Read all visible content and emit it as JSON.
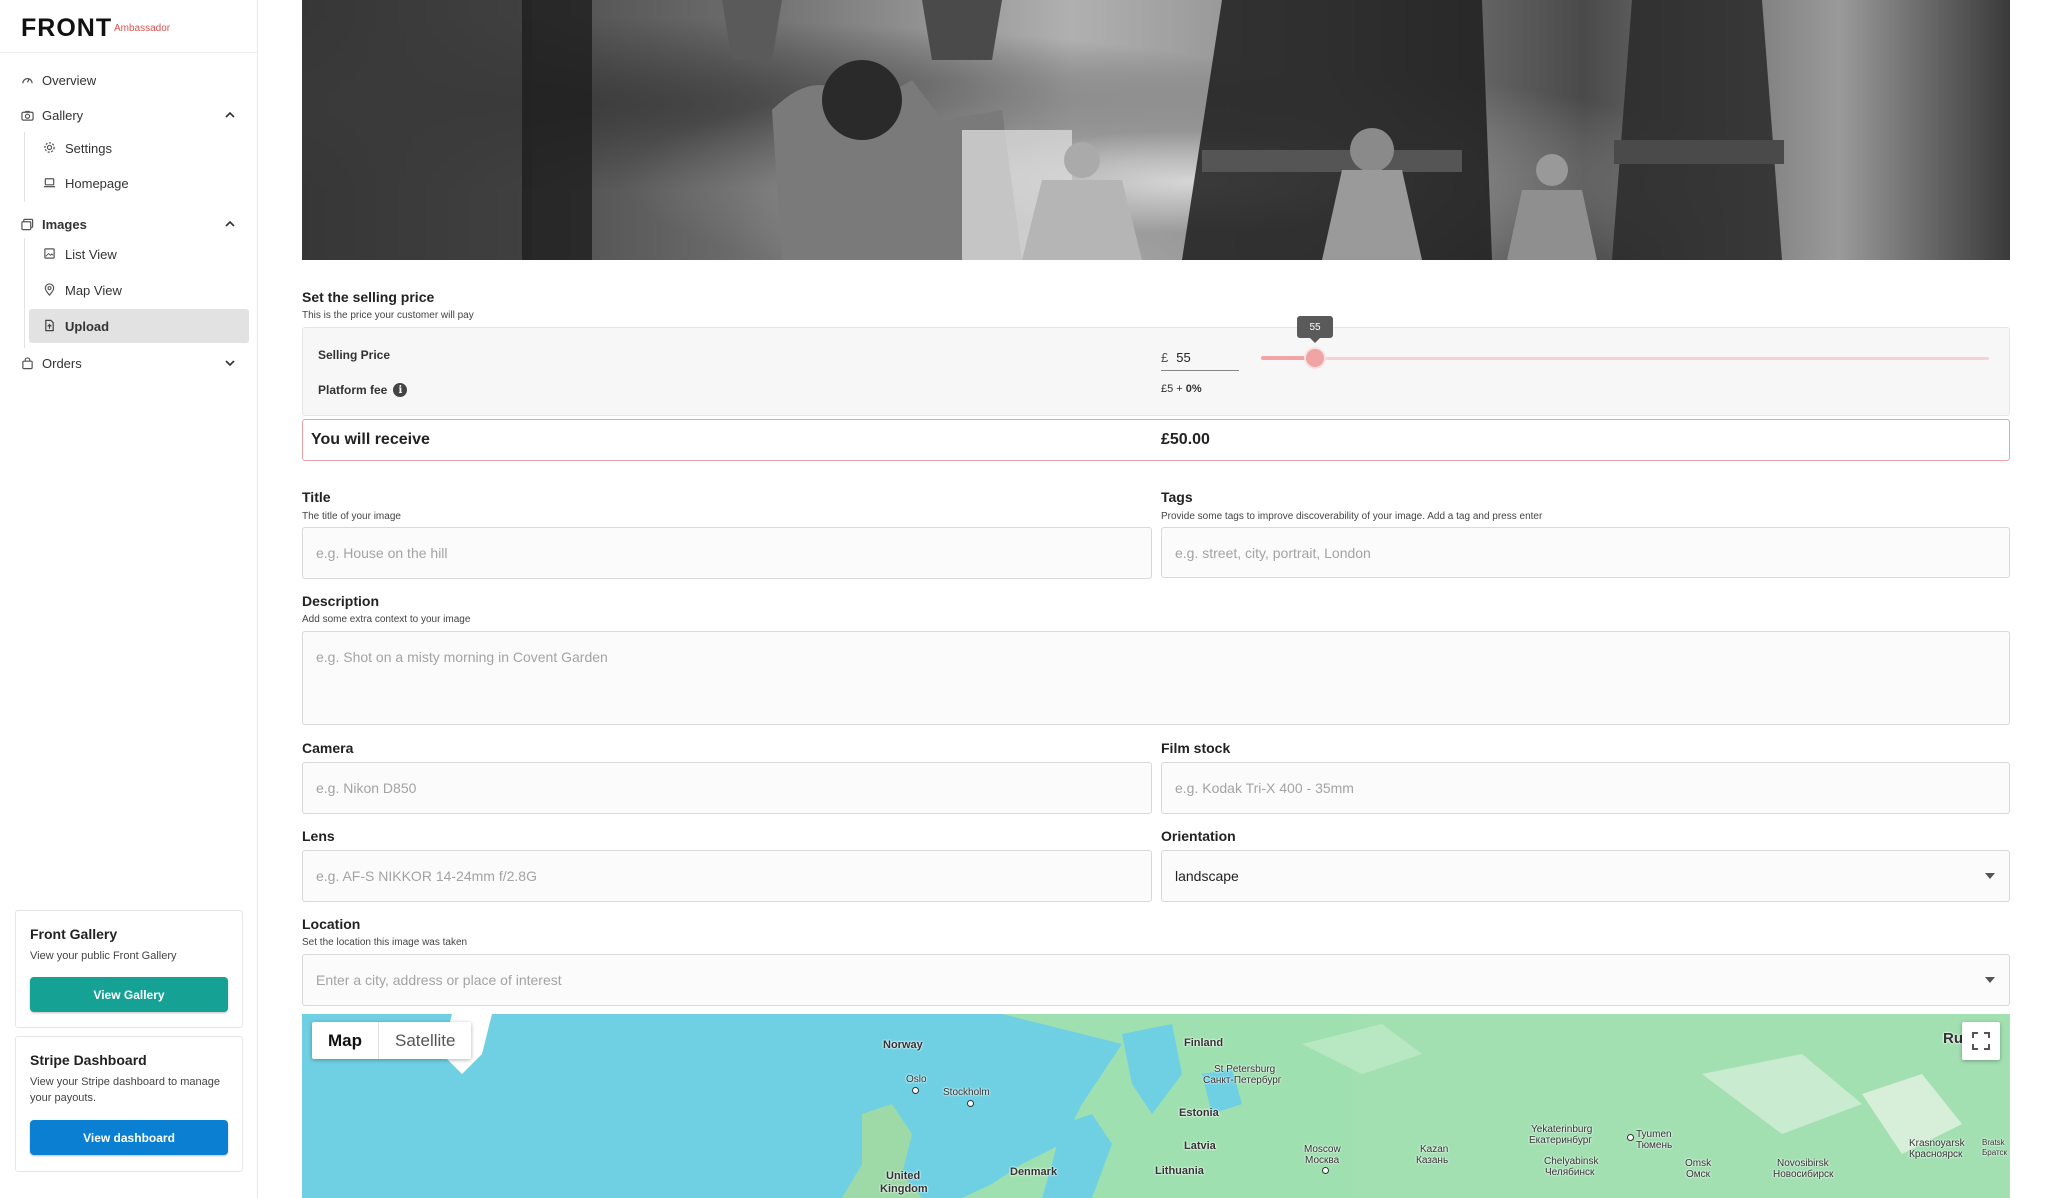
{
  "brand": {
    "logo": "FRONT",
    "sub": "Ambassador"
  },
  "sidebar": {
    "overview": "Overview",
    "gallery": "Gallery",
    "gallery_items": [
      "Settings",
      "Homepage"
    ],
    "images": "Images",
    "images_items": [
      "List View",
      "Map View",
      "Upload"
    ],
    "orders": "Orders",
    "active_item": "Upload"
  },
  "cards": {
    "front": {
      "title": "Front Gallery",
      "text": "View your public Front Gallery",
      "button": "View Gallery",
      "color": "#15a193"
    },
    "stripe": {
      "title": "Stripe Dashboard",
      "text": "View your Stripe dashboard to manage your payouts.",
      "button": "View dashboard",
      "color": "#0b7fd1"
    }
  },
  "pricing": {
    "title": "Set the selling price",
    "help": "This is the price your customer will pay",
    "selling_label": "Selling Price",
    "currency": "£",
    "selling_value": "55",
    "slider_value": 55,
    "slider_fraction": 0.074,
    "tooltip": "55",
    "fee_label": "Platform fee",
    "fee_base": "£5 + ",
    "fee_percent": "0%",
    "receive_label": "You will receive",
    "receive_value": "£50.00",
    "accent": "#f0a4a4"
  },
  "form": {
    "title": {
      "label": "Title",
      "help": "The title of your image",
      "placeholder": "e.g. House on the hill"
    },
    "tags": {
      "label": "Tags",
      "help": "Provide some tags to improve discoverability of your image. Add a tag and press enter",
      "placeholder": "e.g. street, city, portrait, London"
    },
    "description": {
      "label": "Description",
      "help": "Add some extra context to your image",
      "placeholder": "e.g. Shot on a misty morning in Covent Garden"
    },
    "camera": {
      "label": "Camera",
      "placeholder": "e.g. Nikon D850"
    },
    "film": {
      "label": "Film stock",
      "placeholder": "e.g. Kodak Tri-X 400 - 35mm"
    },
    "lens": {
      "label": "Lens",
      "placeholder": "e.g. AF-S NIKKOR 14-24mm f/2.8G"
    },
    "orientation": {
      "label": "Orientation",
      "value": "landscape"
    },
    "location": {
      "label": "Location",
      "help": "Set the location this image was taken",
      "placeholder": "Enter a city, address or place of interest"
    }
  },
  "map": {
    "tab_map": "Map",
    "tab_satellite": "Satellite",
    "labels": {
      "norway": "Norway",
      "oslo": "Oslo",
      "stockholm": "Stockholm",
      "finland": "Finland",
      "stpete": "St Petersburg",
      "stpete_ru": "Санкт-Петербург",
      "estonia": "Estonia",
      "latvia": "Latvia",
      "lithuania": "Lithuania",
      "denmark": "Denmark",
      "uk1": "United",
      "uk2": "Kingdom",
      "moscow": "Moscow",
      "moscow_ru": "Москва",
      "kazan": "Kazan",
      "kazan_ru": "Казань",
      "yek": "Yekaterinburg",
      "yek_ru": "Екатеринбург",
      "chel": "Chelyabinsk",
      "chel_ru": "Челябинск",
      "tyumen": "Tyumen",
      "tyumen_ru": "Тюмень",
      "omsk": "Omsk",
      "omsk_ru": "Омск",
      "novo": "Novosibirsk",
      "novo_ru": "Новосибирск",
      "kras": "Krasnoyarsk",
      "kras_ru": "Красноярск",
      "bratsk": "Bratsk",
      "bratsk_ru": "Братск",
      "ru": "Ru"
    }
  }
}
